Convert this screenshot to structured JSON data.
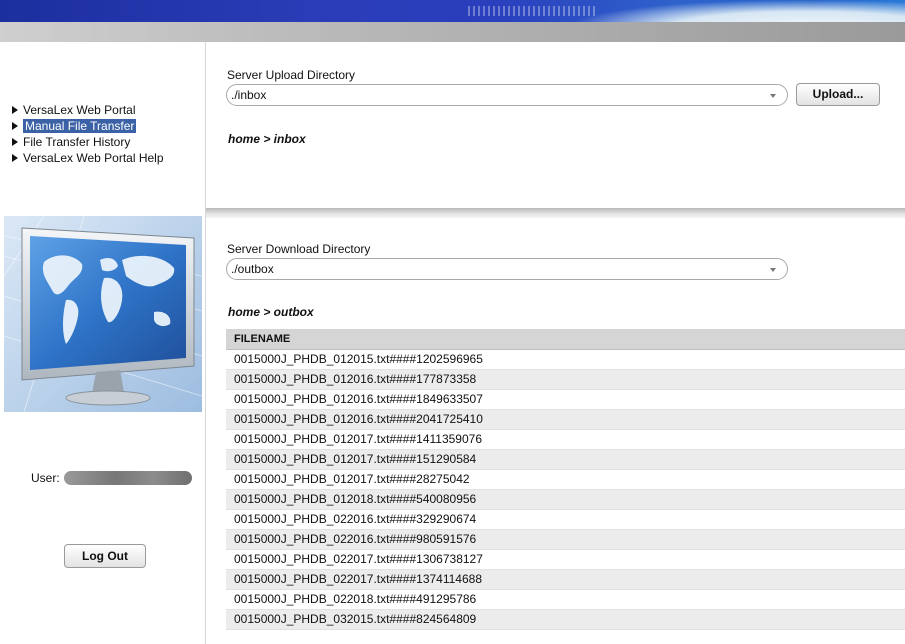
{
  "nav": {
    "items": [
      {
        "label": "VersaLex Web Portal"
      },
      {
        "label": "Manual File Transfer"
      },
      {
        "label": "File Transfer History"
      },
      {
        "label": "VersaLex Web Portal Help"
      }
    ],
    "active_index": 1
  },
  "user": {
    "label": "User:",
    "logout_label": "Log Out"
  },
  "upload": {
    "label": "Server Upload Directory",
    "directory": "./inbox",
    "button_label": "Upload...",
    "breadcrumb": "home > inbox"
  },
  "download": {
    "label": "Server Download Directory",
    "directory": "./outbox",
    "breadcrumb": "home > outbox"
  },
  "files": {
    "column_header": "FILENAME",
    "rows": [
      "0015000J_PHDB_012015.txt####1202596965",
      "0015000J_PHDB_012016.txt####177873358",
      "0015000J_PHDB_012016.txt####1849633507",
      "0015000J_PHDB_012016.txt####2041725410",
      "0015000J_PHDB_012017.txt####1411359076",
      "0015000J_PHDB_012017.txt####151290584",
      "0015000J_PHDB_012017.txt####28275042",
      "0015000J_PHDB_012018.txt####540080956",
      "0015000J_PHDB_022016.txt####329290674",
      "0015000J_PHDB_022016.txt####980591576",
      "0015000J_PHDB_022017.txt####1306738127",
      "0015000J_PHDB_022017.txt####1374114688",
      "0015000J_PHDB_022018.txt####491295786",
      "0015000J_PHDB_032015.txt####824564809"
    ]
  },
  "colors": {
    "accent": "#3b62a6",
    "banner": "#2b3cb8"
  }
}
